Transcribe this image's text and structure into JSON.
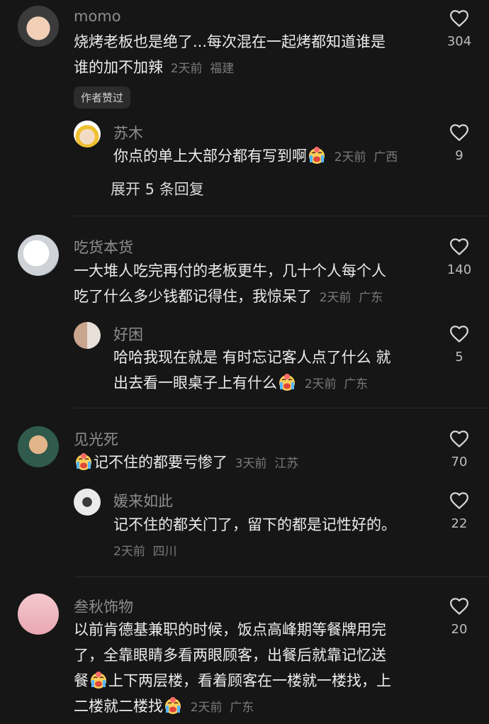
{
  "comments": [
    {
      "user": "momo",
      "line1": "烧烤老板也是绝了...每次混在一起烤都知道谁是",
      "line2": "谁的加不加辣",
      "time": "2天前",
      "region": "福建",
      "likes": "304",
      "badge": "作者赞过",
      "reply": {
        "user": "苏木",
        "text": "你点的单上大部分都有写到啊",
        "time": "2天前",
        "region": "广西",
        "likes": "9"
      },
      "expand": "展开 5 条回复"
    },
    {
      "user": "吃货本货",
      "line1": "一大堆人吃完再付的老板更牛，几十个人每个人",
      "line2": "吃了什么多少钱都记得住，我惊呆了",
      "time": "2天前",
      "region": "广东",
      "likes": "140",
      "reply": {
        "user": "好困",
        "line1": "哈哈我现在就是 有时忘记客人点了什么 就",
        "line2": "出去看一眼桌子上有什么",
        "time": "2天前",
        "region": "广东",
        "likes": "5"
      }
    },
    {
      "user": "见光死",
      "text": "记不住的都要亏惨了",
      "time": "3天前",
      "region": "江苏",
      "likes": "70",
      "reply": {
        "user": "媛来如此",
        "text": "记不住的都关门了，留下的都是记性好的。",
        "time": "2天前",
        "region": "四川",
        "likes": "22"
      }
    },
    {
      "user": "叁秋饰物",
      "line1": "以前肯德基兼职的时候，饭点高峰期等餐牌用完",
      "line2": "了，全靠眼睛多看两眼顾客，出餐后就靠记忆送",
      "line3a": "餐",
      "line3b": "上下两层楼，看着顾客在一楼就一楼找，上",
      "line4": "二楼就二楼找",
      "time": "2天前",
      "region": "广东",
      "likes": "20"
    }
  ]
}
